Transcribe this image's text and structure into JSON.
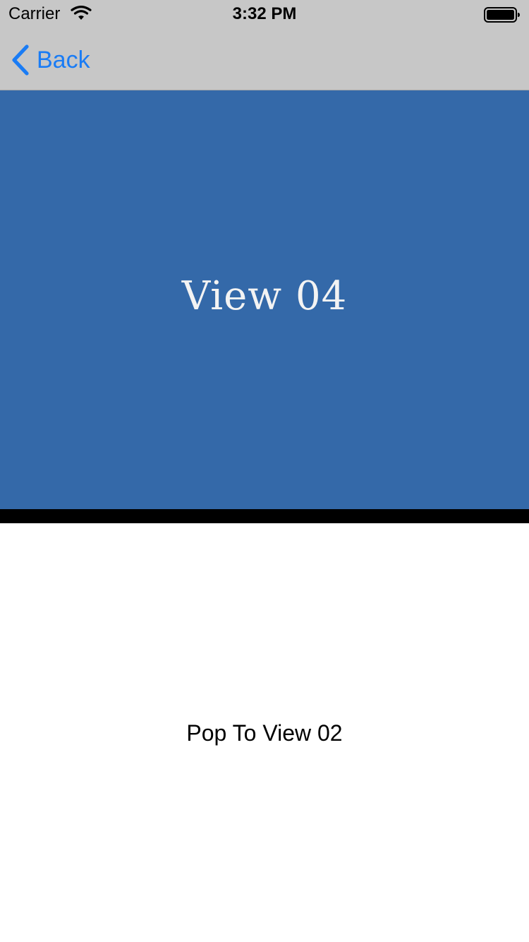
{
  "status_bar": {
    "carrier": "Carrier",
    "time": "3:32 PM",
    "wifi_icon": "wifi-icon",
    "battery_icon": "battery-icon"
  },
  "nav_bar": {
    "back_label": "Back",
    "back_icon": "chevron-left-icon"
  },
  "hero": {
    "title": "View 04"
  },
  "actions": {
    "pop_label": "Pop To View 02"
  },
  "colors": {
    "nav_background": "#c7c7c7",
    "tint": "#1a7cf5",
    "hero_background": "#3469a9",
    "hero_text": "#f3f3f3",
    "divider": "#000000",
    "content_background": "#ffffff"
  }
}
